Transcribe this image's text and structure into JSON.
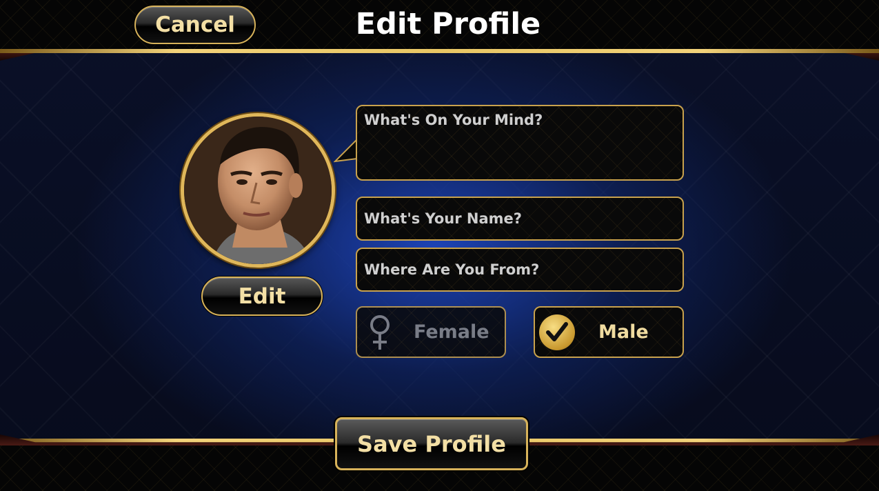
{
  "header": {
    "cancel_label": "Cancel",
    "title": "Edit Profile"
  },
  "profile": {
    "edit_label": "Edit",
    "mind_placeholder": "What's On Your Mind?",
    "name_placeholder": "What's Your Name?",
    "from_placeholder": "Where Are You From?"
  },
  "gender": {
    "female_label": "Female",
    "male_label": "Male",
    "selected": "Male"
  },
  "footer": {
    "save_label": "Save Profile"
  },
  "icons": {
    "female": "female-symbol-icon",
    "check": "checkmark-icon",
    "avatar": "profile-photo"
  },
  "colors": {
    "gold": "#d8b35a",
    "gold_text": "#f3dfa5",
    "background_blue": "#1e46be"
  }
}
